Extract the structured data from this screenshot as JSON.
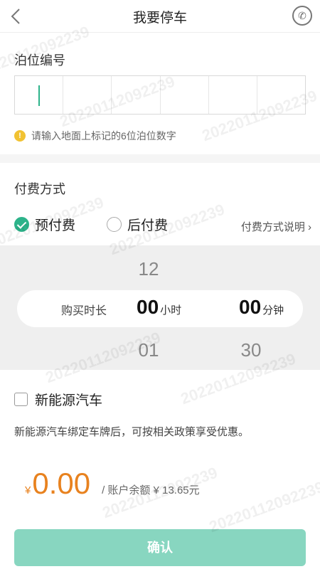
{
  "header": {
    "title": "我要停车",
    "back_icon": "chevron-left-icon",
    "phone_icon": "phone-icon"
  },
  "slot": {
    "label": "泊位编号",
    "cells": 6,
    "hint": "请输入地面上标记的6位泊位数字",
    "hint_icon": "!"
  },
  "payment": {
    "label": "付费方式",
    "options": [
      {
        "label": "预付费",
        "checked": true
      },
      {
        "label": "后付费",
        "checked": false
      }
    ],
    "explain_link": "付费方式说明 ›"
  },
  "picker": {
    "label": "购买时长",
    "hours_prev": "12",
    "hours": "00",
    "hours_unit": "小时",
    "hours_next": "01",
    "minutes": "00",
    "minutes_unit": "分钟",
    "minutes_next": "30"
  },
  "new_energy": {
    "label": "新能源汽车",
    "checked": false,
    "note": "新能源汽车绑定车牌后，可按相关政策享受优惠。"
  },
  "price": {
    "currency": "¥",
    "amount": "0.00",
    "balance": "/ 账户余额 ¥ 13.65元"
  },
  "confirm": {
    "label": "确认"
  },
  "colors": {
    "accent": "#2db38a",
    "price": "#e8821f",
    "button": "#88d6c0"
  }
}
